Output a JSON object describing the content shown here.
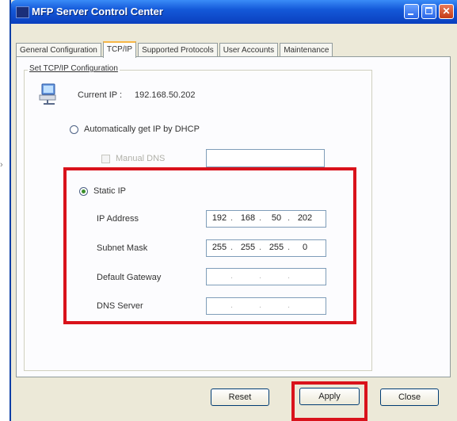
{
  "window": {
    "title": "MFP Server Control Center"
  },
  "tabs": [
    {
      "label": "General Configuration",
      "active": false
    },
    {
      "label": "TCP/IP",
      "active": true
    },
    {
      "label": "Supported Protocols",
      "active": false
    },
    {
      "label": "User Accounts",
      "active": false
    },
    {
      "label": "Maintenance",
      "active": false
    }
  ],
  "group": {
    "title": "Set TCP/IP Configuration"
  },
  "current_ip": {
    "label": "Current IP :",
    "value": "192.168.50.202"
  },
  "dhcp": {
    "label": "Automatically get IP by DHCP",
    "selected": false
  },
  "manual_dns": {
    "label": "Manual DNS",
    "checked": false,
    "enabled": false,
    "value": ""
  },
  "static_ip": {
    "label": "Static IP",
    "selected": true
  },
  "fields": {
    "ip_address": {
      "label": "IP Address",
      "octets": [
        "192",
        "168",
        "50",
        "202"
      ]
    },
    "subnet_mask": {
      "label": "Subnet Mask",
      "octets": [
        "255",
        "255",
        "255",
        "0"
      ]
    },
    "default_gateway": {
      "label": "Default Gateway",
      "octets": [
        "",
        "",
        "",
        ""
      ]
    },
    "dns_server": {
      "label": "DNS Server",
      "octets": [
        "",
        "",
        "",
        ""
      ]
    }
  },
  "buttons": {
    "reset": "Reset",
    "apply": "Apply",
    "close": "Close"
  },
  "highlight_color": "#D9121B",
  "icons": [
    "computer-network-icon",
    "minimize-icon",
    "maximize-icon",
    "close-icon"
  ]
}
